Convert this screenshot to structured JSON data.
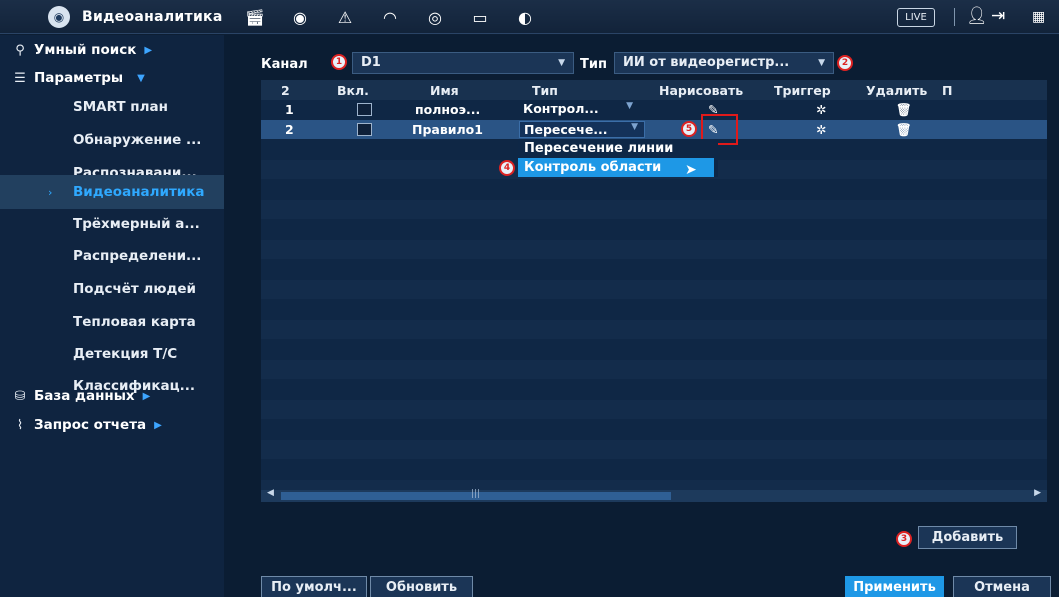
{
  "app": {
    "title": "Видеоаналитика",
    "live_label": "LIVE"
  },
  "sidebar": {
    "smart_search": "Умный поиск",
    "parameters": "Параметры",
    "items": [
      "SMART план",
      "Обнаружение ...",
      "Распознавани...",
      "Видеоаналитика",
      "Трёхмерный а...",
      "Распределени...",
      "Подсчёт людей",
      "Тепловая карта",
      "Детекция Т/С",
      "Классификац..."
    ],
    "database": "База данных",
    "report": "Запрос отчета"
  },
  "filters": {
    "channel_label": "Канал",
    "channel_value": "D1",
    "type_label": "Тип",
    "type_value": "ИИ от видеорегистр..."
  },
  "table": {
    "headers": [
      "2",
      "Вкл.",
      "Имя",
      "Тип",
      "Нарисовать",
      "Триггер",
      "Удалить",
      "П"
    ],
    "rows": [
      {
        "num": "1",
        "name": "полноэ...",
        "type": "Контрол..."
      },
      {
        "num": "2",
        "name": "Правило1",
        "type": "Пересече..."
      }
    ]
  },
  "dropdown": {
    "options": [
      "Пересечение линии",
      "Контроль области"
    ]
  },
  "badges": [
    "1",
    "2",
    "3",
    "4",
    "5"
  ],
  "buttons": {
    "add": "Добавить",
    "default": "По умолч...",
    "refresh": "Обновить",
    "apply": "Применить",
    "cancel": "Отмена"
  },
  "colors": {
    "accent": "#1e98e6",
    "highlight": "#2fa9ff",
    "annotation": "#e01a1a"
  }
}
